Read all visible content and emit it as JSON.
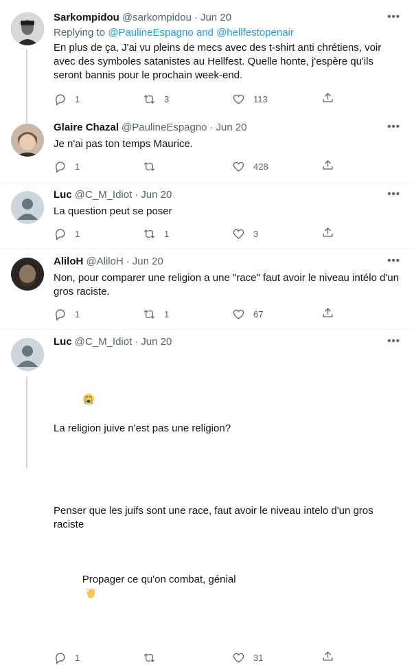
{
  "tweets": [
    {
      "name": "Sarkompidou",
      "handle": "@sarkompidou",
      "date": "Jun 20",
      "reply_prefix": "Replying to ",
      "reply_user1": "@PaulineEspagno",
      "reply_and": " and ",
      "reply_user2": "@hellfestopenair",
      "text": "En plus de ça, J'ai vu pleins de mecs avec des t-shirt anti chrétiens, voir avec des symboles satanistes au Hellfest. Quelle honte, j'espère qu'ils seront bannis pour le prochain week-end.",
      "replies": "1",
      "retweets": "3",
      "likes": "113"
    },
    {
      "name": "Glaire Chazal",
      "handle": "@PaulineEspagno",
      "date": "Jun 20",
      "text": "Je n'ai pas ton temps Maurice.",
      "replies": "1",
      "retweets": "",
      "likes": "428"
    },
    {
      "name": "Luc",
      "handle": "@C_M_Idiot",
      "date": "Jun 20",
      "text": "La question peut se poser",
      "replies": "1",
      "retweets": "1",
      "likes": "3"
    },
    {
      "name": "AliloH",
      "handle": "@AliloH",
      "date": "Jun 20",
      "text": "Non, pour comparer une religion a une \"race\" faut avoir le niveau intélo d'un gros raciste.",
      "replies": "1",
      "retweets": "1",
      "likes": "67"
    },
    {
      "name": "Luc",
      "handle": "@C_M_Idiot",
      "date": "Jun 20",
      "text_line1": "La religion juive n'est pas une religion?",
      "text_line2": "Penser que les juifs sont une race, faut avoir le niveau intelo d'un gros raciste",
      "text_line3": "Propager ce qu'on combat, génial",
      "replies": "1",
      "retweets": "",
      "likes": "31"
    }
  ],
  "more_label": "•••",
  "colors": {
    "link": "#1d9bf0",
    "secondary": "#536471",
    "divider": "#eff3f4",
    "thread": "#cfd9de"
  }
}
